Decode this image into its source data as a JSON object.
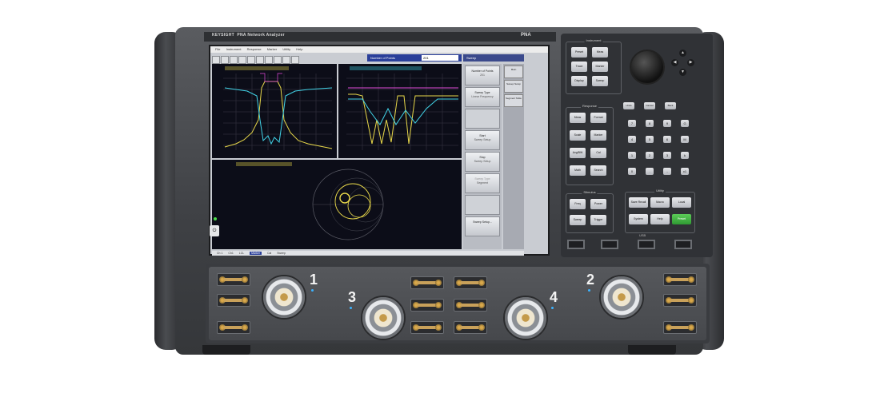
{
  "instrument": {
    "brand": "KEYSIGHT",
    "model_line": "PNA Network Analyzer",
    "badge": "PNA"
  },
  "screen": {
    "menu": [
      "File",
      "Instrument",
      "Response",
      "Marker",
      "Utility",
      "Help"
    ],
    "entry": {
      "label": "Number of Points",
      "value": "201"
    },
    "softkey_menu_title": "Sweep",
    "softkeys": [
      {
        "label": "Number of Points",
        "sub": "201",
        "disabled": false
      },
      {
        "label": "Sweep Type",
        "sub": "Linear Frequency",
        "disabled": false
      },
      {
        "label": "",
        "sub": "",
        "disabled": false
      },
      {
        "label": "Start",
        "sub": "Sweep Setup",
        "disabled": false
      },
      {
        "label": "Stop",
        "sub": "Sweep Setup",
        "disabled": false
      },
      {
        "label": "Sweep Type",
        "sub": "Segment",
        "disabled": true
      },
      {
        "label": "",
        "sub": "",
        "disabled": false
      },
      {
        "label": "Sweep Setup...",
        "sub": "",
        "disabled": false
      }
    ],
    "side_tabs": [
      "Main",
      "Sweep Setup",
      "Segment Table"
    ],
    "status": [
      "Ch 1",
      "Ch1",
      "LCL",
      "Marker",
      "Cal",
      "Sweep"
    ],
    "trace_colors": {
      "yellow": "#e8d84a",
      "cyan": "#42d4e8",
      "magenta": "#e04ad8",
      "white": "#e0e0e0"
    }
  },
  "front_panel": {
    "instrument_group": {
      "title": "Instrument",
      "keys": [
        "Preset",
        "Meas",
        "Trace",
        "Marker",
        "Display",
        "Sweep"
      ]
    },
    "response_group": {
      "title": "Response",
      "keys": [
        "Meas",
        "Format",
        "Scale",
        "Marker",
        "Avg/BW",
        "Cal",
        "Math",
        "Search"
      ]
    },
    "entry_keys": [
      "7",
      "8",
      "9",
      "4",
      "5",
      "6",
      "1",
      "2",
      "3",
      "0",
      ".",
      "-",
      "G",
      "M",
      "k",
      "x1"
    ],
    "entry_top": [
      "Undo",
      "Cancel",
      "Back"
    ],
    "stimulus_group": {
      "title": "Stimulus",
      "keys": [
        "Freq",
        "Power",
        "Sweep",
        "Trigger"
      ]
    },
    "utility_group": {
      "title": "Utility",
      "keys": [
        "Save Recall",
        "Macro",
        "Local",
        "System",
        "Help",
        "Preset"
      ]
    },
    "arrows": [
      "▲",
      "◀",
      "▶",
      "▼"
    ],
    "usb_label": "USB"
  },
  "ports": {
    "p1": "1",
    "p2": "2",
    "p3": "3",
    "p4": "4"
  }
}
